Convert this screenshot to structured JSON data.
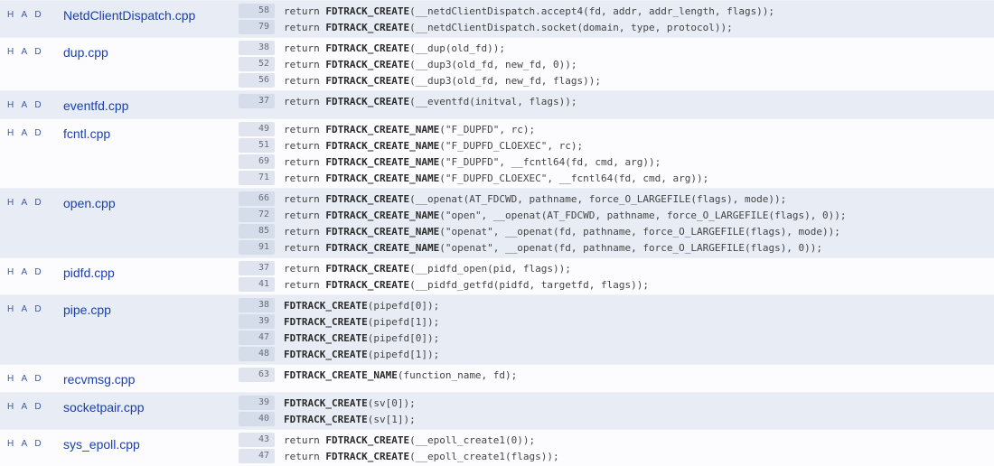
{
  "flags_label": "H A D",
  "files": [
    {
      "name": "NetdClientDispatch.cpp",
      "alt": true,
      "lines": [
        {
          "n": 58,
          "pre": "return ",
          "bold": "FDTRACK_CREATE",
          "post": "(__netdClientDispatch.accept4(fd, addr, addr_length, flags));"
        },
        {
          "n": 79,
          "pre": "return ",
          "bold": "FDTRACK_CREATE",
          "post": "(__netdClientDispatch.socket(domain, type, protocol));"
        }
      ]
    },
    {
      "name": "dup.cpp",
      "alt": false,
      "lines": [
        {
          "n": 38,
          "pre": "return ",
          "bold": "FDTRACK_CREATE",
          "post": "(__dup(old_fd));"
        },
        {
          "n": 52,
          "pre": "return ",
          "bold": "FDTRACK_CREATE",
          "post": "(__dup3(old_fd, new_fd, 0));"
        },
        {
          "n": 56,
          "pre": "return ",
          "bold": "FDTRACK_CREATE",
          "post": "(__dup3(old_fd, new_fd, flags));"
        }
      ]
    },
    {
      "name": "eventfd.cpp",
      "alt": true,
      "lines": [
        {
          "n": 37,
          "pre": "return ",
          "bold": "FDTRACK_CREATE",
          "post": "(__eventfd(initval, flags));"
        }
      ]
    },
    {
      "name": "fcntl.cpp",
      "alt": false,
      "lines": [
        {
          "n": 49,
          "pre": "return ",
          "bold": "FDTRACK_CREATE_NAME",
          "post": "(\"F_DUPFD\", rc);"
        },
        {
          "n": 51,
          "pre": "return ",
          "bold": "FDTRACK_CREATE_NAME",
          "post": "(\"F_DUPFD_CLOEXEC\", rc);"
        },
        {
          "n": 69,
          "pre": "return ",
          "bold": "FDTRACK_CREATE_NAME",
          "post": "(\"F_DUPFD\", __fcntl64(fd, cmd, arg));"
        },
        {
          "n": 71,
          "pre": "return ",
          "bold": "FDTRACK_CREATE_NAME",
          "post": "(\"F_DUPFD_CLOEXEC\", __fcntl64(fd, cmd, arg));"
        }
      ]
    },
    {
      "name": "open.cpp",
      "alt": true,
      "lines": [
        {
          "n": 66,
          "pre": "return ",
          "bold": "FDTRACK_CREATE",
          "post": "(__openat(AT_FDCWD, pathname, force_O_LARGEFILE(flags), mode));"
        },
        {
          "n": 72,
          "pre": "return ",
          "bold": "FDTRACK_CREATE_NAME",
          "post": "(\"open\", __openat(AT_FDCWD, pathname, force_O_LARGEFILE(flags), 0));"
        },
        {
          "n": 85,
          "pre": "return ",
          "bold": "FDTRACK_CREATE_NAME",
          "post": "(\"openat\", __openat(fd, pathname, force_O_LARGEFILE(flags), mode));"
        },
        {
          "n": 91,
          "pre": "return ",
          "bold": "FDTRACK_CREATE_NAME",
          "post": "(\"openat\", __openat(fd, pathname, force_O_LARGEFILE(flags), 0));"
        }
      ]
    },
    {
      "name": "pidfd.cpp",
      "alt": false,
      "lines": [
        {
          "n": 37,
          "pre": "return ",
          "bold": "FDTRACK_CREATE",
          "post": "(__pidfd_open(pid, flags));"
        },
        {
          "n": 41,
          "pre": "return ",
          "bold": "FDTRACK_CREATE",
          "post": "(__pidfd_getfd(pidfd, targetfd, flags));"
        }
      ]
    },
    {
      "name": "pipe.cpp",
      "alt": true,
      "lines": [
        {
          "n": 38,
          "pre": "",
          "bold": "FDTRACK_CREATE",
          "post": "(pipefd[0]);"
        },
        {
          "n": 39,
          "pre": "",
          "bold": "FDTRACK_CREATE",
          "post": "(pipefd[1]);"
        },
        {
          "n": 47,
          "pre": "",
          "bold": "FDTRACK_CREATE",
          "post": "(pipefd[0]);"
        },
        {
          "n": 48,
          "pre": "",
          "bold": "FDTRACK_CREATE",
          "post": "(pipefd[1]);"
        }
      ]
    },
    {
      "name": "recvmsg.cpp",
      "alt": false,
      "lines": [
        {
          "n": 63,
          "pre": "",
          "bold": "FDTRACK_CREATE_NAME",
          "post": "(function_name, fd);"
        }
      ]
    },
    {
      "name": "socketpair.cpp",
      "alt": true,
      "lines": [
        {
          "n": 39,
          "pre": "",
          "bold": "FDTRACK_CREATE",
          "post": "(sv[0]);"
        },
        {
          "n": 40,
          "pre": "",
          "bold": "FDTRACK_CREATE",
          "post": "(sv[1]);"
        }
      ]
    },
    {
      "name": "sys_epoll.cpp",
      "alt": false,
      "lines": [
        {
          "n": 43,
          "pre": "return ",
          "bold": "FDTRACK_CREATE",
          "post": "(__epoll_create1(0));"
        },
        {
          "n": 47,
          "pre": "return ",
          "bold": "FDTRACK_CREATE",
          "post": "(__epoll_create1(flags));"
        }
      ]
    }
  ]
}
